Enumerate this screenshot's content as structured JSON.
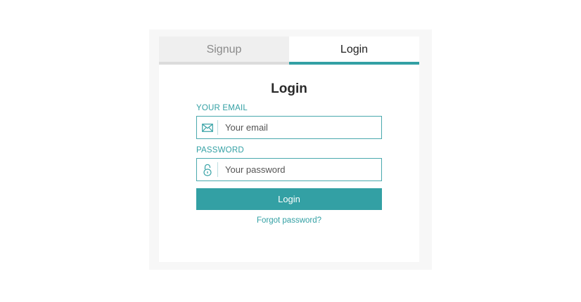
{
  "tabs": [
    {
      "label": "Signup",
      "active": false
    },
    {
      "label": "Login",
      "active": true
    }
  ],
  "form": {
    "title": "Login",
    "email": {
      "label": "YOUR EMAIL",
      "placeholder": "Your email",
      "value": "",
      "icon": "envelope-icon"
    },
    "password": {
      "label": "PASSWORD",
      "placeholder": "Your password",
      "value": "",
      "icon": "lock-icon"
    },
    "submit_label": "Login",
    "forgot_label": "Forgot password?"
  },
  "colors": {
    "accent": "#33a0a4",
    "inactive_tab_bg": "#efefef",
    "inactive_tab_text": "#8a8a8a",
    "outer_bg": "#f7f7f7"
  }
}
